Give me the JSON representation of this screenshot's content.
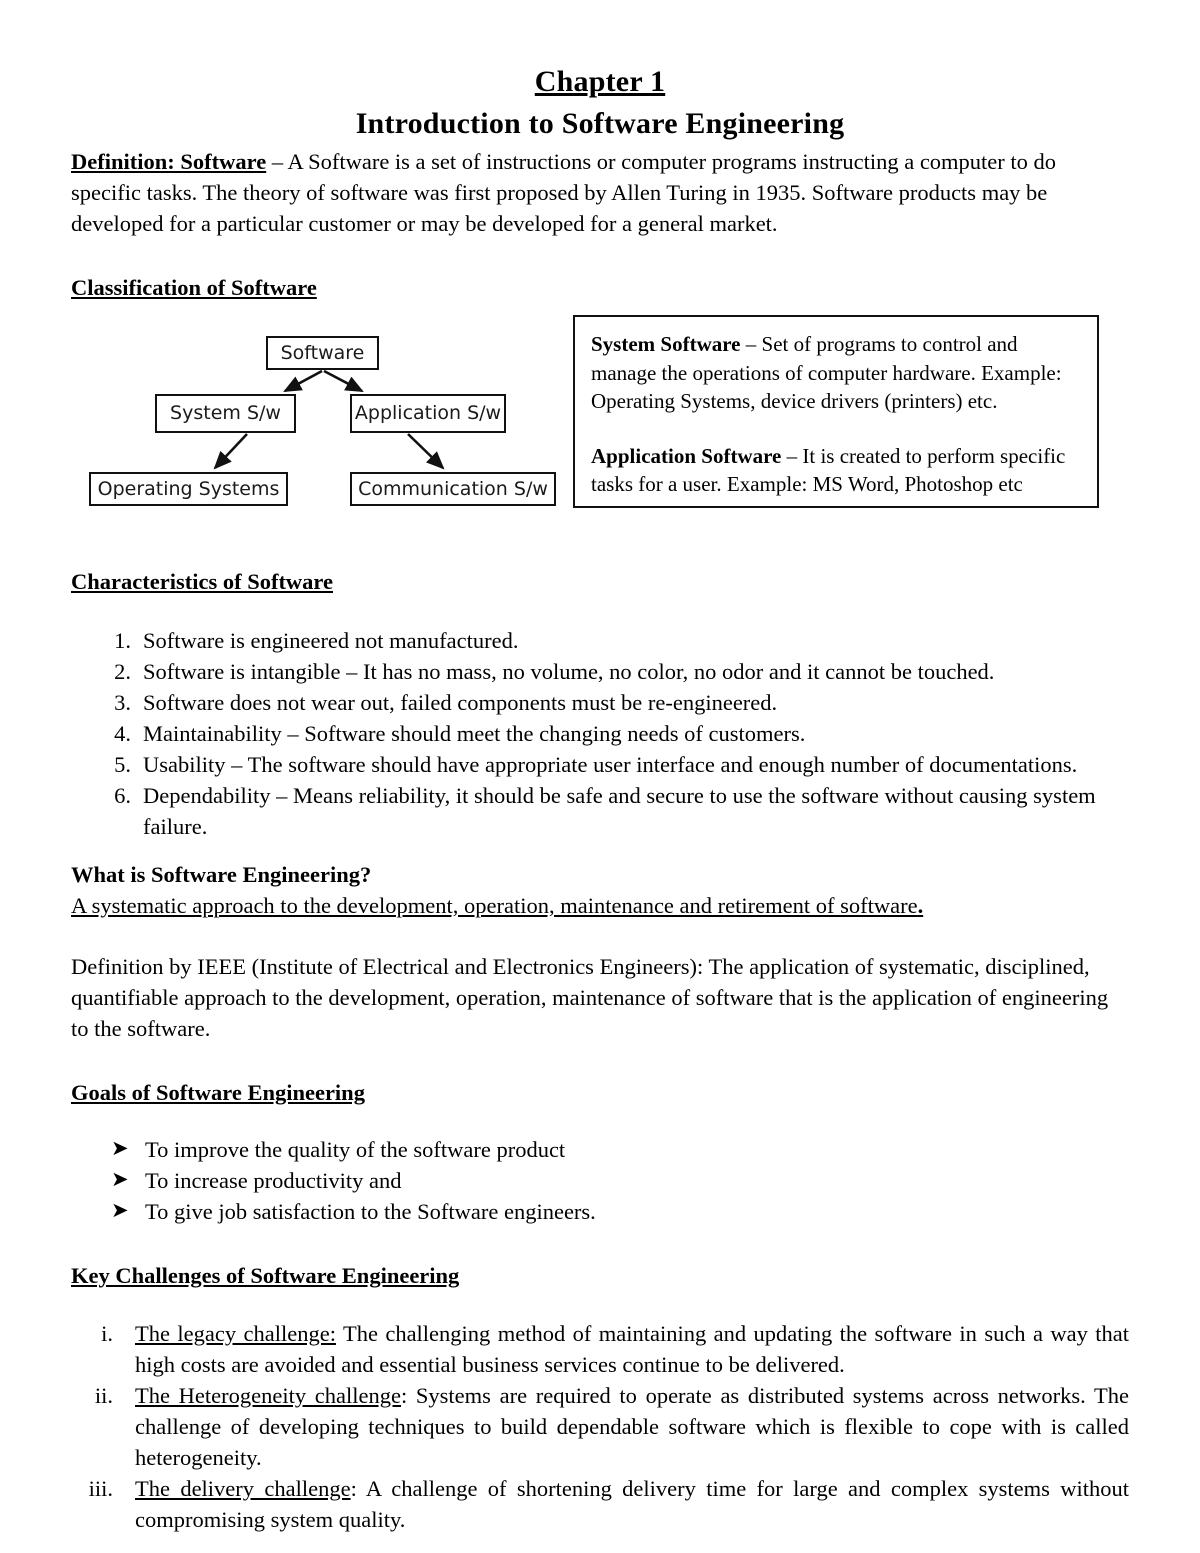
{
  "document": {
    "chapter_label": "Chapter 1",
    "title": "Introduction to Software Engineering"
  },
  "definition": {
    "lead": "Definition: Software",
    "body": " – A Software is a set of instructions or computer programs instructing a computer to do specific tasks. The theory of software was first proposed by Allen Turing in 1935. Software products may be developed for a particular customer or may be developed for a general market."
  },
  "sections": {
    "classification": "Classification of Software",
    "characteristics": "Characteristics of Software",
    "what_is_se": "What is Software Engineering?",
    "goals": "Goals of Software Engineering",
    "key_challenges": "Key Challenges of Software Engineering"
  },
  "diagram": {
    "nodes": [
      {
        "id": "software",
        "label": "Software"
      },
      {
        "id": "system-sw",
        "label": "System S/w"
      },
      {
        "id": "application-sw",
        "label": "Application S/w"
      },
      {
        "id": "operating-systems",
        "label": "Operating Systems"
      },
      {
        "id": "communication-sw",
        "label": "Communication S/w"
      }
    ],
    "edges": [
      {
        "from": "software",
        "to": "system-sw"
      },
      {
        "from": "software",
        "to": "application-sw"
      },
      {
        "from": "system-sw",
        "to": "operating-systems"
      },
      {
        "from": "application-sw",
        "to": "communication-sw"
      }
    ]
  },
  "info_box": {
    "system_software_term": "System Software",
    "system_software_text": " – Set of programs to control and manage the operations of computer hardware. Example: Operating Systems, device drivers (printers) etc.",
    "application_software_term": "Application Software",
    "application_software_text": " – It is created to perform specific tasks for a user. Example: MS Word, Photoshop etc"
  },
  "characteristics": [
    {
      "marker": "1.",
      "text": "Software is engineered not manufactured."
    },
    {
      "marker": "2.",
      "text": "Software is intangible – It has no mass, no volume, no color, no odor and it cannot be touched."
    },
    {
      "marker": "3.",
      "text": "Software does not wear out, failed components must be re-engineered."
    },
    {
      "marker": "4.",
      "text": "Maintainability – Software should meet the changing needs of customers."
    },
    {
      "marker": "5.",
      "text": "Usability – The software should have appropriate user interface and enough number of documentations."
    },
    {
      "marker": "6.",
      "text": "Dependability – Means reliability, it should be safe and secure to use the software without causing system failure."
    }
  ],
  "what_is_se": {
    "underlined_answer": "A systematic approach to the development, operation, maintenance and retirement of software",
    "answer_period": ".",
    "ieee_definition": "Definition by IEEE (Institute of Electrical and Electronics Engineers): The application of systematic, disciplined, quantifiable approach to the development, operation, maintenance of software that is the application of engineering to the software."
  },
  "goals": [
    {
      "bullet": "➤",
      "text": "To improve the quality of the software product"
    },
    {
      "bullet": "➤",
      "text": "To increase productivity and"
    },
    {
      "bullet": "➤",
      "text": "To give job satisfaction to the Software engineers."
    }
  ],
  "challenges": [
    {
      "marker": "i.",
      "lead": "The legacy challenge:",
      "text": " The challenging method of maintaining and updating the software in such a way that high costs are avoided and essential business services continue to be delivered."
    },
    {
      "marker": "ii.",
      "lead": "The Heterogeneity challenge",
      "text": ": Systems are required to operate as distributed systems across networks. The challenge of developing techniques to build dependable software which is flexible to cope with is called heterogeneity."
    },
    {
      "marker": "iii.",
      "lead": "The delivery challenge",
      "text": ": A challenge of shortening delivery time for large and complex systems without compromising system quality."
    }
  ],
  "colors": {
    "text": "#000000",
    "page_background": "#ffffff",
    "diagram_border": "#111111"
  }
}
